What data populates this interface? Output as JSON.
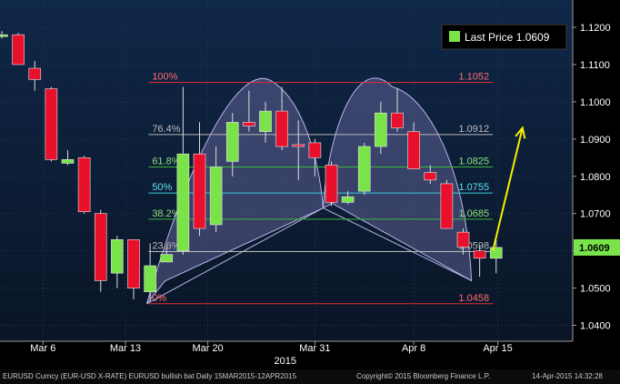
{
  "chart_data": {
    "type": "candlestick",
    "ylim": [
      1.036,
      1.124
    ],
    "yticks": [
      "1.1200",
      "1.1100",
      "1.1000",
      "1.0900",
      "1.0800",
      "1.0700",
      "1.0600",
      "1.0500",
      "1.0400"
    ],
    "xticks": [
      {
        "label": "Mar 6",
        "i": 2.5
      },
      {
        "label": "Mar 13",
        "i": 7.5
      },
      {
        "label": "Mar 20",
        "i": 12.5
      },
      {
        "label": "Mar 31",
        "i": 19
      },
      {
        "label": "Apr 8",
        "i": 25
      },
      {
        "label": "Apr 15",
        "i": 30.1
      }
    ],
    "year_label": "2015",
    "year_i": 17.2,
    "candles": [
      {
        "o": 1.118,
        "h": 1.119,
        "l": 1.117,
        "c": 1.118
      },
      {
        "o": 1.118,
        "h": 1.1185,
        "l": 1.11,
        "c": 1.11
      },
      {
        "o": 1.109,
        "h": 1.111,
        "l": 1.103,
        "c": 1.106
      },
      {
        "o": 1.1035,
        "h": 1.104,
        "l": 1.084,
        "c": 1.0845
      },
      {
        "o": 1.0835,
        "h": 1.087,
        "l": 1.083,
        "c": 1.0845
      },
      {
        "o": 1.085,
        "h": 1.0855,
        "l": 1.07,
        "c": 1.0705
      },
      {
        "o": 1.07,
        "h": 1.071,
        "l": 1.049,
        "c": 1.052
      },
      {
        "o": 1.054,
        "h": 1.064,
        "l": 1.05,
        "c": 1.063
      },
      {
        "o": 1.063,
        "h": 1.063,
        "l": 1.047,
        "c": 1.05
      },
      {
        "o": 1.049,
        "h": 1.062,
        "l": 1.0465,
        "c": 1.056
      },
      {
        "o": 1.057,
        "h": 1.061,
        "l": 1.057,
        "c": 1.059
      },
      {
        "o": 1.06,
        "h": 1.104,
        "l": 1.059,
        "c": 1.086
      },
      {
        "o": 1.086,
        "h": 1.0945,
        "l": 1.064,
        "c": 1.066
      },
      {
        "o": 1.067,
        "h": 1.088,
        "l": 1.065,
        "c": 1.0825
      },
      {
        "o": 1.084,
        "h": 1.097,
        "l": 1.08,
        "c": 1.0945
      },
      {
        "o": 1.0945,
        "h": 1.103,
        "l": 1.092,
        "c": 1.0935
      },
      {
        "o": 1.092,
        "h": 1.1,
        "l": 1.089,
        "c": 1.0975
      },
      {
        "o": 1.0975,
        "h": 1.104,
        "l": 1.087,
        "c": 1.088
      },
      {
        "o": 1.0885,
        "h": 1.095,
        "l": 1.079,
        "c": 1.088
      },
      {
        "o": 1.089,
        "h": 1.09,
        "l": 1.08,
        "c": 1.085
      },
      {
        "o": 1.083,
        "h": 1.084,
        "l": 1.072,
        "c": 1.073
      },
      {
        "o": 1.073,
        "h": 1.076,
        "l": 1.0725,
        "c": 1.0745
      },
      {
        "o": 1.076,
        "h": 1.089,
        "l": 1.075,
        "c": 1.088
      },
      {
        "o": 1.088,
        "h": 1.1,
        "l": 1.086,
        "c": 1.097
      },
      {
        "o": 1.097,
        "h": 1.1035,
        "l": 1.092,
        "c": 1.093
      },
      {
        "o": 1.092,
        "h": 1.0945,
        "l": 1.082,
        "c": 1.082
      },
      {
        "o": 1.081,
        "h": 1.083,
        "l": 1.078,
        "c": 1.079
      },
      {
        "o": 1.078,
        "h": 1.079,
        "l": 1.066,
        "c": 1.066
      },
      {
        "o": 1.065,
        "h": 1.066,
        "l": 1.059,
        "c": 1.061
      },
      {
        "o": 1.06,
        "h": 1.0615,
        "l": 1.053,
        "c": 1.058
      },
      {
        "o": 1.058,
        "h": 1.063,
        "l": 1.054,
        "c": 1.0609
      }
    ],
    "fib_levels": [
      {
        "left": "100%",
        "right": "1.1052",
        "y": 1.1052,
        "color": "#e03030",
        "left_color": "#ff6a6a",
        "right_color": "#ff6a6a"
      },
      {
        "left": "76.4%",
        "right": "1.0912",
        "y": 1.0912,
        "color": "#b8b8b8",
        "left_color": "#bdbdbd",
        "right_color": "#bdbdbd"
      },
      {
        "left": "61.8%",
        "right": "1.0825",
        "y": 1.0825,
        "color": "#3ab83a",
        "left_color": "#8ee07a",
        "right_color": "#8ee07a"
      },
      {
        "left": "50%",
        "right": "1.0755",
        "y": 1.0755,
        "color": "#38c8d8",
        "left_color": "#5de0f0",
        "right_color": "#5de0f0"
      },
      {
        "left": "38.2%",
        "right": "1.0685",
        "y": 1.0685,
        "color": "#3ab83a",
        "left_color": "#8ee07a",
        "right_color": "#8ee07a"
      },
      {
        "left": "23.6%",
        "right": "1.0598",
        "y": 1.0598,
        "color": "#b8b8b8",
        "left_color": "#bdbdbd",
        "right_color": "#bdbdbd"
      },
      {
        "left": "0%",
        "right": "1.0458",
        "y": 1.0458,
        "color": "#e03030",
        "left_color": "#ff6a6a",
        "right_color": "#ff6a6a"
      }
    ],
    "last_price_label": "Last Price",
    "last_price_value": "1.0609",
    "last_price": 1.0609,
    "colors": {
      "up": "#7be34a",
      "down": "#e8102a",
      "axis_text": "#ffffff",
      "bg_top": "#0f2748",
      "bg_bottom": "#0a1526",
      "pattern_fill": "#8d86c8",
      "arrow": "#f4f000"
    }
  },
  "footer": {
    "left": "EURUSD Curncy (EUR-USD X-RATE) EURUSD bullish bat  Daily 15MAR2015-12APR2015",
    "middle": "Copyright© 2015 Bloomberg Finance L.P.",
    "right": "14-Apr-2015 14:32:28"
  }
}
